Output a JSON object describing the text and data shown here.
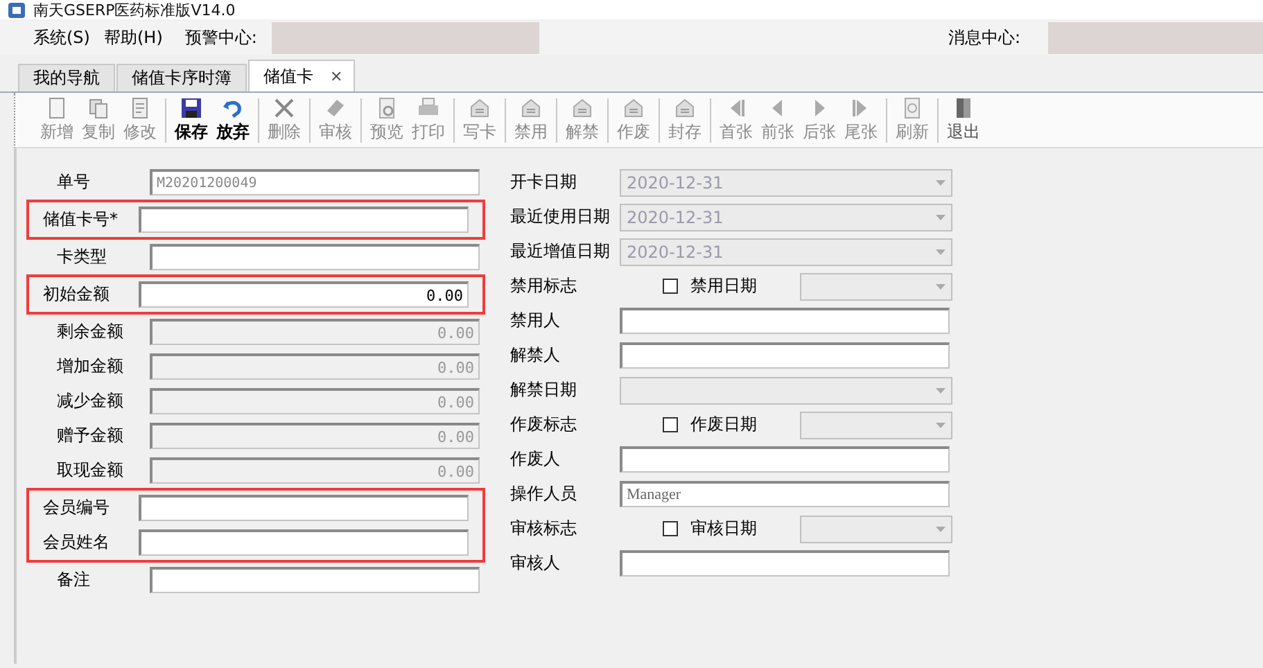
{
  "window": {
    "title": "南天GSERP医药标准版V14.0"
  },
  "menu": [
    {
      "label": "系统(S)"
    },
    {
      "label": "帮助(H)"
    }
  ],
  "alert_center": {
    "label": "预警中心:"
  },
  "message_center": {
    "label": "消息中心:"
  },
  "tabs": [
    {
      "label": "我的导航",
      "selected": false,
      "closable": false
    },
    {
      "label": "储值卡序时簿",
      "selected": false,
      "closable": false
    },
    {
      "label": "储值卡",
      "selected": true,
      "closable": true,
      "close": "✕"
    }
  ],
  "toolbar": [
    {
      "buttons": [
        {
          "label": "新增",
          "disabled": true
        },
        {
          "label": "复制",
          "disabled": true
        },
        {
          "label": "修改",
          "disabled": true
        }
      ]
    },
    {
      "buttons": [
        {
          "label": "保存",
          "disabled": false
        },
        {
          "label": "放弃",
          "disabled": false
        }
      ]
    },
    {
      "buttons": [
        {
          "label": "删除",
          "disabled": true
        }
      ]
    },
    {
      "buttons": [
        {
          "label": "审核",
          "disabled": true
        }
      ]
    },
    {
      "buttons": [
        {
          "label": "预览",
          "disabled": true
        },
        {
          "label": "打印",
          "disabled": true
        }
      ]
    },
    {
      "buttons": [
        {
          "label": "写卡",
          "disabled": true
        }
      ]
    },
    {
      "buttons": [
        {
          "label": "禁用",
          "disabled": true
        }
      ]
    },
    {
      "buttons": [
        {
          "label": "解禁",
          "disabled": true
        }
      ]
    },
    {
      "buttons": [
        {
          "label": "作废",
          "disabled": true
        }
      ]
    },
    {
      "buttons": [
        {
          "label": "封存",
          "disabled": true
        }
      ]
    },
    {
      "buttons": [
        {
          "label": "首张",
          "disabled": true
        },
        {
          "label": "前张",
          "disabled": true
        },
        {
          "label": "后张",
          "disabled": true
        },
        {
          "label": "尾张",
          "disabled": true
        }
      ]
    },
    {
      "buttons": [
        {
          "label": "刷新",
          "disabled": true
        }
      ]
    },
    {
      "buttons": [
        {
          "label": "退出",
          "disabled": false
        }
      ]
    }
  ],
  "left_fields": [
    {
      "label": "单号",
      "kind": "input",
      "value": "M20201200049",
      "highlighted": false
    },
    {
      "label": "储值卡号*",
      "kind": "input",
      "highlighted": true
    },
    {
      "label": "卡类型",
      "kind": "input",
      "highlighted": false
    },
    {
      "label": "初始金额",
      "kind": "amount",
      "value": "0.00",
      "highlighted": true
    },
    {
      "label": "剩余金额",
      "kind": "readonly",
      "value": "0.00",
      "highlighted": false
    },
    {
      "label": "增加金额",
      "kind": "readonly",
      "value": "0.00",
      "highlighted": false
    },
    {
      "label": "减少金额",
      "kind": "readonly",
      "value": "0.00",
      "highlighted": false
    },
    {
      "label": "赠予金额",
      "kind": "readonly",
      "value": "0.00",
      "highlighted": false
    },
    {
      "label": "取现金额",
      "kind": "readonly",
      "value": "0.00",
      "highlighted": false
    },
    {
      "label": "会员编号",
      "kind": "input",
      "highlighted": true
    },
    {
      "label": "会员姓名",
      "kind": "input",
      "highlighted": true
    },
    {
      "label": "备注",
      "kind": "input",
      "highlighted": false
    }
  ],
  "right_fields": [
    {
      "label": "开卡日期",
      "kind": "date",
      "value": "2020-12-31"
    },
    {
      "label": "最近使用日期",
      "kind": "date",
      "value": "2020-12-31"
    },
    {
      "label": "最近增值日期",
      "kind": "date",
      "value": "2020-12-31"
    },
    {
      "label": "禁用标志",
      "kind": "flag",
      "checked": false,
      "date_label": "禁用日期"
    },
    {
      "label": "禁用人",
      "kind": "input"
    },
    {
      "label": "解禁人",
      "kind": "input"
    },
    {
      "label": "解禁日期",
      "kind": "date"
    },
    {
      "label": "作废标志",
      "kind": "flag",
      "checked": false,
      "date_label": "作废日期"
    },
    {
      "label": "作废人",
      "kind": "input"
    },
    {
      "label": "操作人员",
      "kind": "input",
      "value": "Manager"
    },
    {
      "label": "审核标志",
      "kind": "flag",
      "checked": false,
      "date_label": "审核日期"
    },
    {
      "label": "审核人",
      "kind": "input"
    }
  ]
}
